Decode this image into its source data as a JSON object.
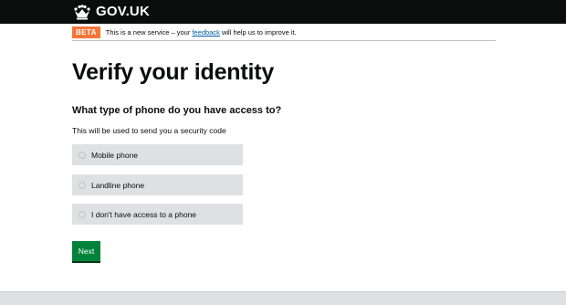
{
  "header": {
    "logo_text": "GOV.UK",
    "logo_icon": "crown-icon",
    "background": "#0b0c0c"
  },
  "phase_banner": {
    "tag": "BETA",
    "text_before": "This is a new service – your ",
    "link_text": "feedback",
    "text_after": " will help us to improve it.",
    "tag_color": "#f47738",
    "link_color": "#005ea5"
  },
  "main": {
    "title": "Verify your identity",
    "question": "What type of phone do you have access to?",
    "hint": "This will be used to send you a security code",
    "options": [
      {
        "label": "Mobile phone",
        "selected": false
      },
      {
        "label": "Landline phone",
        "selected": false
      },
      {
        "label": "I don't have access to a phone",
        "selected": false
      }
    ],
    "next_button": "Next",
    "button_color": "#00823b"
  }
}
